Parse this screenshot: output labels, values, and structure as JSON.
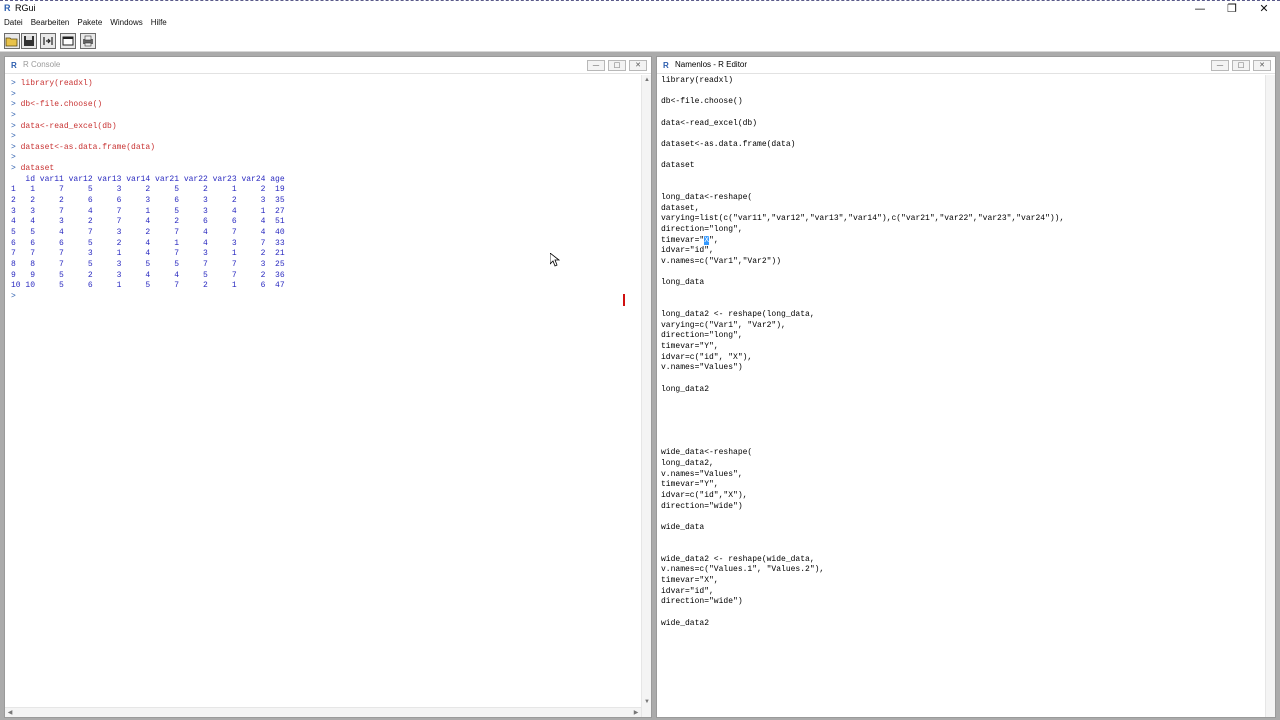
{
  "app": {
    "title": "RGui",
    "icon": "r-app-icon"
  },
  "window_controls": {
    "minimize": "—",
    "restore": "❐",
    "close": "✕"
  },
  "menu": [
    "Datei",
    "Bearbeiten",
    "Pakete",
    "Windows",
    "Hilfe"
  ],
  "toolbar": {
    "buttons": [
      {
        "name": "open-script-icon"
      },
      {
        "name": "save-workspace-icon"
      },
      {
        "name": "load-workspace-icon"
      },
      {
        "name": "copy-paste-icon"
      },
      {
        "name": "print-icon"
      }
    ]
  },
  "console": {
    "title": "R Console",
    "controls": {
      "min": "—",
      "max": "□",
      "close": "✕"
    },
    "lines": [
      {
        "prompt": ">",
        "text": " library(readxl)",
        "kind": "cmd"
      },
      {
        "prompt": ">",
        "text": "",
        "kind": "cmd"
      },
      {
        "prompt": ">",
        "text": " db<-file.choose()",
        "kind": "cmd"
      },
      {
        "prompt": ">",
        "text": "",
        "kind": "cmd"
      },
      {
        "prompt": ">",
        "text": " data<-read_excel(db)",
        "kind": "cmd"
      },
      {
        "prompt": ">",
        "text": "",
        "kind": "cmd"
      },
      {
        "prompt": ">",
        "text": " dataset<-as.data.frame(data)",
        "kind": "cmd"
      },
      {
        "prompt": ">",
        "text": "",
        "kind": "cmd"
      },
      {
        "prompt": ">",
        "text": " dataset",
        "kind": "cmd"
      },
      {
        "prompt": "",
        "text": "   id var11 var12 var13 var14 var21 var22 var23 var24 age",
        "kind": "out"
      },
      {
        "prompt": "",
        "text": "1   1     7     5     3     2     5     2     1     2  19",
        "kind": "out"
      },
      {
        "prompt": "",
        "text": "2   2     2     6     6     3     6     3     2     3  35",
        "kind": "out"
      },
      {
        "prompt": "",
        "text": "3   3     7     4     7     1     5     3     4     1  27",
        "kind": "out"
      },
      {
        "prompt": "",
        "text": "4   4     3     2     7     4     2     6     6     4  51",
        "kind": "out"
      },
      {
        "prompt": "",
        "text": "5   5     4     7     3     2     7     4     7     4  40",
        "kind": "out"
      },
      {
        "prompt": "",
        "text": "6   6     6     5     2     4     1     4     3     7  33",
        "kind": "out"
      },
      {
        "prompt": "",
        "text": "7   7     7     3     1     4     7     3     1     2  21",
        "kind": "out"
      },
      {
        "prompt": "",
        "text": "8   8     7     5     3     5     5     7     7     3  25",
        "kind": "out"
      },
      {
        "prompt": "",
        "text": "9   9     5     2     3     4     4     5     7     2  36",
        "kind": "out"
      },
      {
        "prompt": "",
        "text": "10 10     5     6     1     5     7     2     1     6  47",
        "kind": "out"
      },
      {
        "prompt": ">",
        "text": "",
        "kind": "cmd"
      }
    ]
  },
  "editor": {
    "title": "Namenlos - R Editor",
    "controls": {
      "min": "—",
      "max": "□",
      "close": "✕"
    },
    "lines": [
      "library(readxl)",
      "",
      "db<-file.choose()",
      "",
      "data<-read_excel(db)",
      "",
      "dataset<-as.data.frame(data)",
      "",
      "dataset",
      "",
      "",
      "long_data<-reshape(",
      "dataset,",
      "varying=list(c(\"var11\",\"var12\",\"var13\",\"var14\"),c(\"var21\",\"var22\",\"var23\",\"var24\")),",
      "direction=\"long\",",
      "timevar=\"",
      "idvar=\"id\",",
      "v.names=c(\"Var1\",\"Var2\"))",
      "",
      "long_data",
      "",
      "",
      "long_data2 <- reshape(long_data,",
      "varying=c(\"Var1\", \"Var2\"),",
      "direction=\"long\",",
      "timevar=\"Y\",",
      "idvar=c(\"id\", \"X\"),",
      "v.names=\"Values\")",
      "",
      "long_data2",
      "",
      "",
      "",
      "",
      "",
      "wide_data<-reshape(",
      "long_data2,",
      "v.names=\"Values\",",
      "timevar=\"Y\",",
      "idvar=c(\"id\",\"X\"),",
      "direction=\"wide\")",
      "",
      "wide_data",
      "",
      "",
      "wide_data2 <- reshape(wide_data,",
      "v.names=c(\"Values.1\", \"Values.2\"),",
      "timevar=\"X\",",
      "idvar=\"id\",",
      "direction=\"wide\")",
      "",
      "wide_data2"
    ],
    "selected_text": "X",
    "timevar_suffix": "\","
  }
}
